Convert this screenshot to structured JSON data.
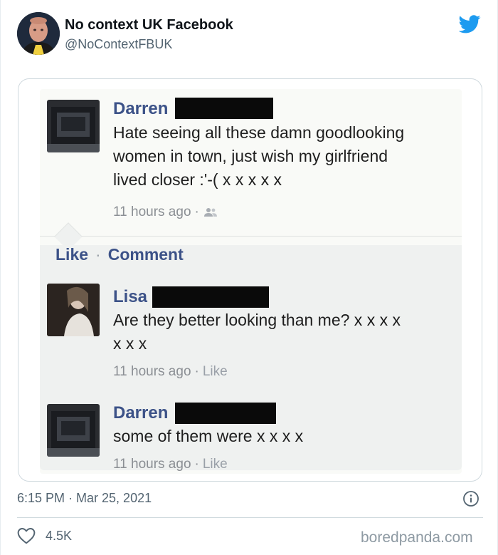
{
  "tweet": {
    "author_name": "No context UK Facebook",
    "author_handle": "@NoContextFBUK",
    "timestamp": "6:15 PM · Mar 25, 2021",
    "like_count": "4.5K",
    "watermark": "boredpanda.com",
    "accent_color": "#1d9bf0",
    "icons": [
      "avatar",
      "twitter-bird-icon",
      "info-icon",
      "heart-icon"
    ]
  },
  "facebook_post": {
    "post": {
      "author": "Darren",
      "lines": [
        "Hate seeing all these damn goodlooking",
        "women in town, just wish my girlfriend",
        "lived closer :'-( x x x x x"
      ],
      "time": "11 hours ago",
      "sep": "·",
      "privacy_icon": "friends-icon"
    },
    "actions": {
      "like": "Like",
      "dot": "·",
      "comment": "Comment"
    },
    "comments": [
      {
        "author": "Lisa",
        "lines": [
          "Are they better looking than me? x x x x",
          "x x x"
        ],
        "time": "11 hours ago",
        "sep": "·",
        "like": "Like"
      },
      {
        "author": "Darren",
        "lines": [
          "some of them were x x x x"
        ],
        "time": "11 hours ago",
        "sep": "·",
        "like": "Like"
      }
    ],
    "name_color": "#3c5288"
  }
}
